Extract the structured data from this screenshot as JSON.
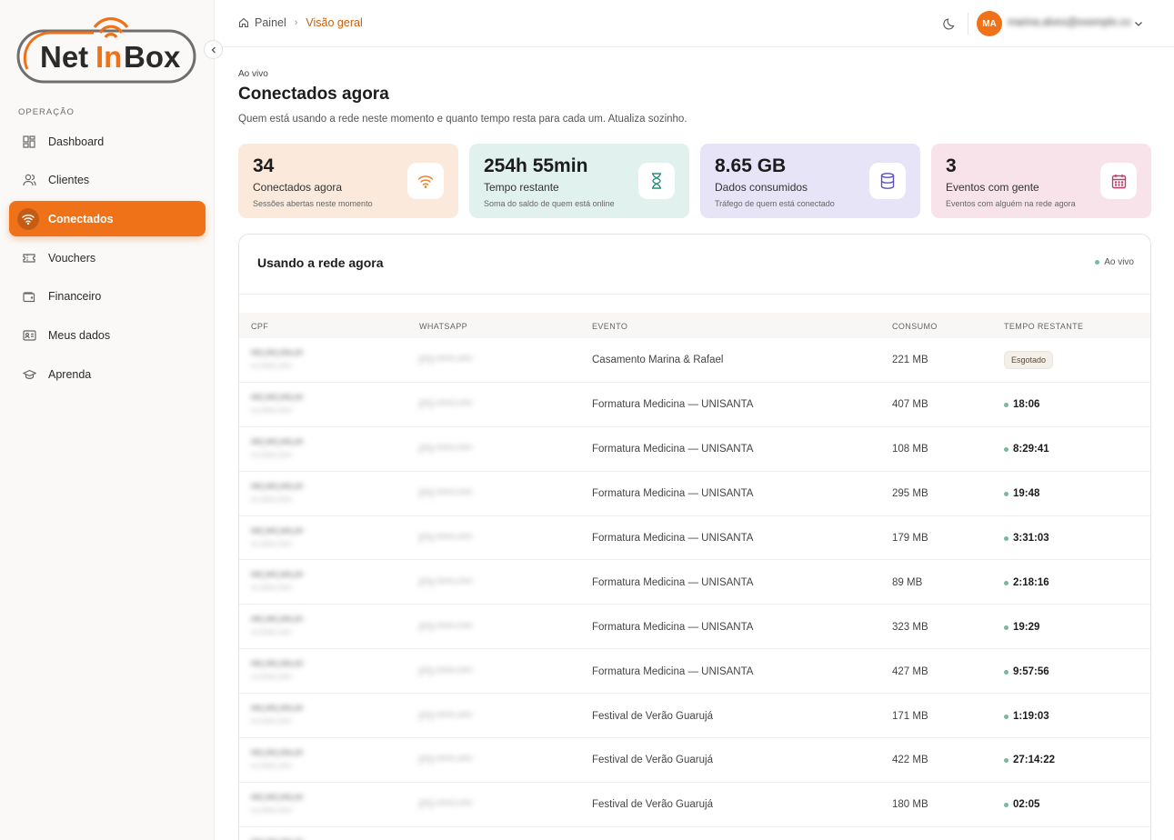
{
  "sidebar": {
    "logo_text": "NetInBox",
    "section_label": "OPERAÇÃO",
    "items": [
      {
        "label": "Dashboard",
        "icon": "dashboard-icon"
      },
      {
        "label": "Clientes",
        "icon": "users-icon"
      },
      {
        "label": "Conectados",
        "icon": "wifi-icon",
        "active": true
      },
      {
        "label": "Vouchers",
        "icon": "ticket-icon"
      },
      {
        "label": "Financeiro",
        "icon": "wallet-icon"
      },
      {
        "label": "Meus dados",
        "icon": "id-card-icon"
      },
      {
        "label": "Aprenda",
        "icon": "graduation-cap-icon"
      }
    ]
  },
  "topbar": {
    "breadcrumb": {
      "home": "Painel",
      "current": "Visão geral"
    },
    "avatar_initials": "MA",
    "user_email": "marina.alves@exemplo.com"
  },
  "page": {
    "eyebrow": "Ao vivo",
    "title": "Conectados agora",
    "subtitle": "Quem está usando a rede neste momento e quanto tempo resta para cada um. Atualiza sozinho."
  },
  "cards": [
    {
      "value": "34",
      "label": "Conectados agora",
      "desc": "Sessões abertas neste momento",
      "icon": "wifi-icon",
      "bg": "#fbeadb",
      "accent": "#e0862e"
    },
    {
      "value": "254h 55min",
      "label": "Tempo restante",
      "desc": "Soma do saldo de quem está online",
      "icon": "hourglass-icon",
      "bg": "#e1f1ee",
      "accent": "#2e8c7e"
    },
    {
      "value": "8.65 GB",
      "label": "Dados consumidos",
      "desc": "Tráfego de quem está conectado",
      "icon": "database-icon",
      "bg": "#e7e4f8",
      "accent": "#5b4fc4"
    },
    {
      "value": "3",
      "label": "Eventos com gente",
      "desc": "Eventos com alguém na rede agora",
      "icon": "calendar-icon",
      "bg": "#f8e3ea",
      "accent": "#c43a6a"
    }
  ],
  "panel": {
    "title": "Usando a rede agora",
    "live_label": "Ao vivo",
    "columns": [
      "CPF",
      "WHATSAPP",
      "EVENTO",
      "CONSUMO",
      "TEMPO RESTANTE"
    ],
    "rows": [
      {
        "cpf": "***.***.***-**",
        "cpf_sub": "**-*****-****",
        "whatsapp": "(**) *****-****",
        "evento": "Casamento Marina & Rafael",
        "consumo": "221 MB",
        "tempo": "Esgotado",
        "esgotado": true
      },
      {
        "cpf": "***.***.***-**",
        "cpf_sub": "**-*****-****",
        "whatsapp": "(**) *****-****",
        "evento": "Formatura Medicina — UNISANTA",
        "consumo": "407 MB",
        "tempo": "18:06"
      },
      {
        "cpf": "***.***.***-**",
        "cpf_sub": "**-*****-****",
        "whatsapp": "(**) *****-****",
        "evento": "Formatura Medicina — UNISANTA",
        "consumo": "108 MB",
        "tempo": "8:29:41"
      },
      {
        "cpf": "***.***.***-**",
        "cpf_sub": "**-*****-****",
        "whatsapp": "(**) *****-****",
        "evento": "Formatura Medicina — UNISANTA",
        "consumo": "295 MB",
        "tempo": "19:48"
      },
      {
        "cpf": "***.***.***-**",
        "cpf_sub": "**-*****-****",
        "whatsapp": "(**) *****-****",
        "evento": "Formatura Medicina — UNISANTA",
        "consumo": "179 MB",
        "tempo": "3:31:03"
      },
      {
        "cpf": "***.***.***-**",
        "cpf_sub": "**-*****-****",
        "whatsapp": "(**) *****-****",
        "evento": "Formatura Medicina — UNISANTA",
        "consumo": "89 MB",
        "tempo": "2:18:16"
      },
      {
        "cpf": "***.***.***-**",
        "cpf_sub": "**-*****-****",
        "whatsapp": "(**) *****-****",
        "evento": "Formatura Medicina — UNISANTA",
        "consumo": "323 MB",
        "tempo": "19:29"
      },
      {
        "cpf": "***.***.***-**",
        "cpf_sub": "**-*****-****",
        "whatsapp": "(**) *****-****",
        "evento": "Formatura Medicina — UNISANTA",
        "consumo": "427 MB",
        "tempo": "9:57:56"
      },
      {
        "cpf": "***.***.***-**",
        "cpf_sub": "**-*****-****",
        "whatsapp": "(**) *****-****",
        "evento": "Festival de Verão Guarujá",
        "consumo": "171 MB",
        "tempo": "1:19:03"
      },
      {
        "cpf": "***.***.***-**",
        "cpf_sub": "**-*****-****",
        "whatsapp": "(**) *****-****",
        "evento": "Festival de Verão Guarujá",
        "consumo": "422 MB",
        "tempo": "27:14:22"
      },
      {
        "cpf": "***.***.***-**",
        "cpf_sub": "**-*****-****",
        "whatsapp": "(**) *****-****",
        "evento": "Festival de Verão Guarujá",
        "consumo": "180 MB",
        "tempo": "02:05"
      },
      {
        "cpf": "***.***.***-**",
        "cpf_sub": "**-*****-****",
        "whatsapp": "",
        "evento": "",
        "consumo": "",
        "tempo": ""
      }
    ]
  },
  "colors": {
    "accent": "#ef7218",
    "breadcrumb_current": "#c75e10",
    "live_dot": "#7bb89a"
  }
}
